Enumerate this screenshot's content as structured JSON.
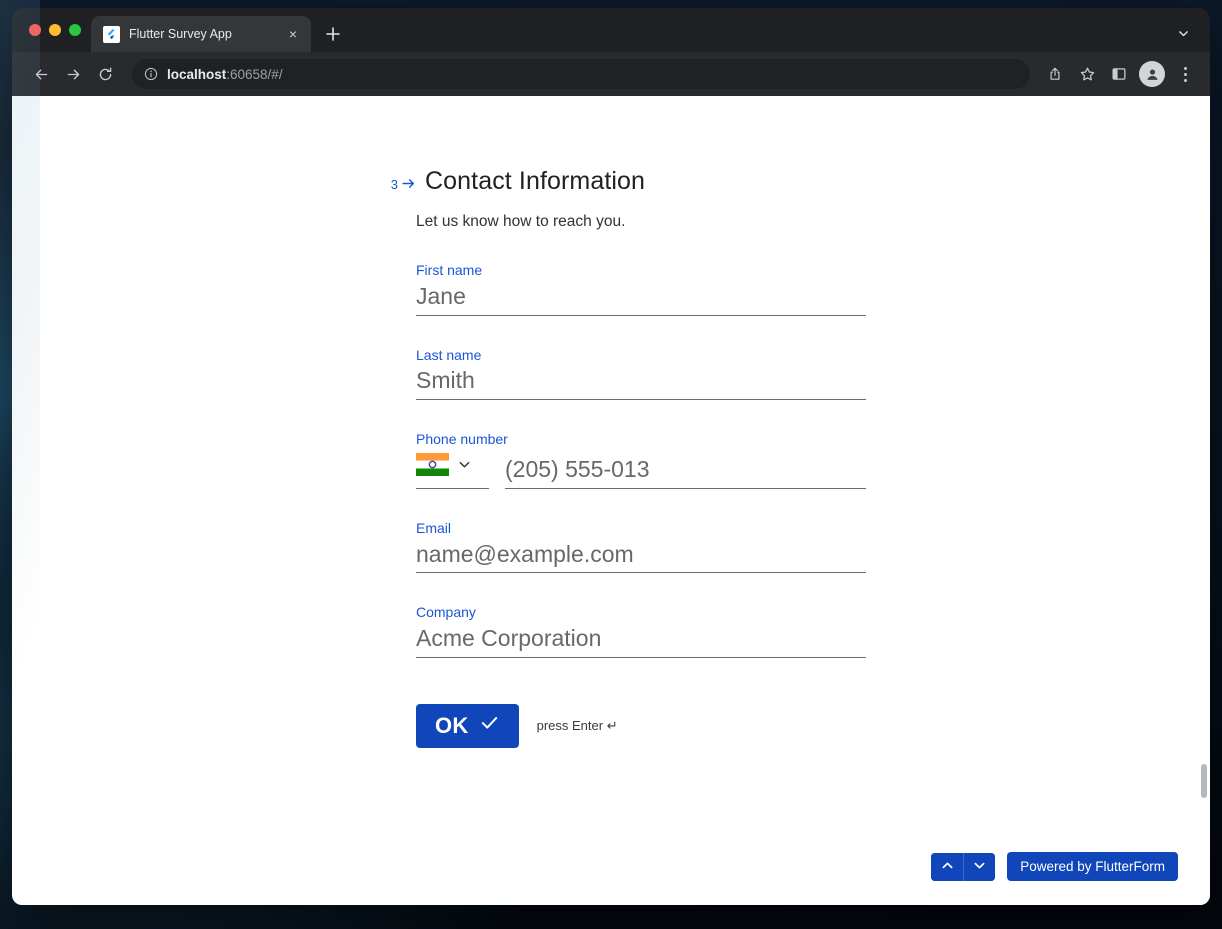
{
  "browser": {
    "tab": {
      "title": "Flutter Survey App",
      "favicon": "flutter-logo-icon",
      "close": "×"
    },
    "new_tab_label": "+",
    "tab_list_chevron": "chevron-down-icon",
    "toolbar": {
      "back": "back-arrow-icon",
      "forward": "forward-arrow-icon",
      "reload": "reload-icon",
      "site_info": "info-circle-icon",
      "url_host": "localhost",
      "url_rest": ":60658/#/",
      "share": "share-icon",
      "bookmark": "star-icon",
      "side_panel": "side-panel-icon",
      "profile": "avatar-icon",
      "menu": "three-dots-icon"
    }
  },
  "page": {
    "step": {
      "number": "3",
      "arrow": "→",
      "title": "Contact Information",
      "subtitle": "Let us know how to reach you."
    },
    "fields": [
      {
        "label": "First name",
        "value": "Jane",
        "name": "first-name"
      },
      {
        "label": "Last name",
        "value": "Smith",
        "name": "last-name"
      },
      {
        "label": "Email",
        "value": "name@example.com",
        "name": "email"
      },
      {
        "label": "Company",
        "value": "Acme Corporation",
        "name": "company"
      }
    ],
    "phone": {
      "label": "Phone number",
      "country_flag": "india-flag-icon",
      "country_chevron": "chevron-down-icon",
      "value": "(205) 555-013"
    },
    "submit": {
      "label": "OK",
      "check": "check-icon",
      "hint": "press Enter ↵"
    },
    "bottom": {
      "prev": "chevron-up-icon",
      "next": "chevron-down-icon",
      "powered_by": "Powered by FlutterForm"
    }
  },
  "colors": {
    "accent_blue": "#1046ba",
    "label_blue": "#1a56d6",
    "value_gray": "#686868",
    "toolbar_bg": "#292a2d",
    "tabstrip_bg": "#1f2024",
    "active_tab_bg": "#35363a"
  }
}
